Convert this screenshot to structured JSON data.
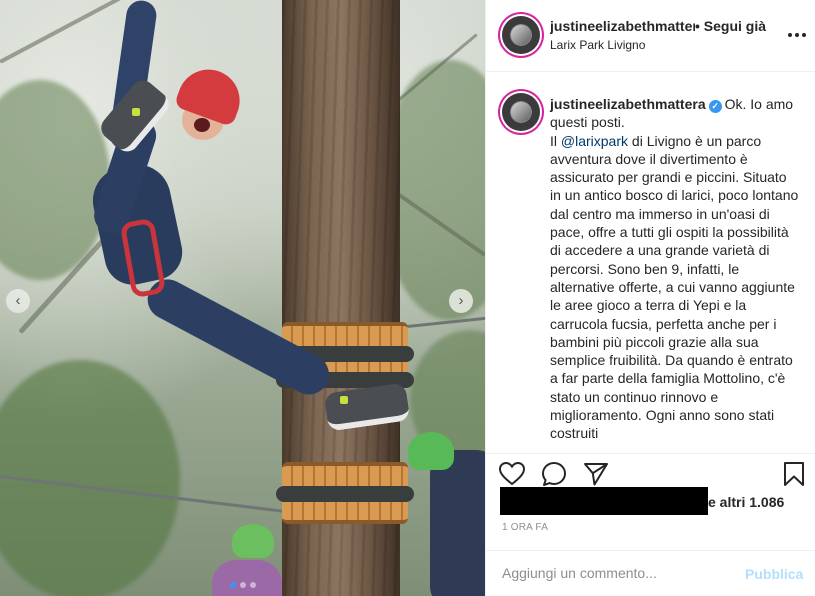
{
  "post": {
    "image_alt": "",
    "has_prev": true,
    "has_next": true,
    "carousel_count": 3,
    "carousel_active": 0
  },
  "header": {
    "username": "justineelizabethmattera",
    "follow_label": "• Segui già",
    "location": "Larix Park Livigno",
    "more_icon": "more-horizontal-icon"
  },
  "caption": {
    "username": "justineelizabethmattera",
    "verified_icon": "verified-badge-icon",
    "intro": "Ok. Io amo questi posti.",
    "pre_mention": "Il ",
    "mention": "@larixpark",
    "body": " di Livigno è un parco avventura dove il divertimento è assicurato per grandi e piccini. Situato in un antico bosco di larici, poco lontano dal centro ma immerso in un'oasi di pace, offre a tutti gli ospiti la possibilità di accedere a una grande varietà di percorsi. Sono ben 9, infatti, le alternative offerte, a cui vanno aggiunte le aree gioco a terra di Yepi e la carrucola fucsia, perfetta anche per i bambini più piccoli grazie alla sua semplice fruibilità. Da quando è entrato a far parte della famiglia Mottolino, c'è stato un continuo rinnovo e miglioramento. Ogni anno sono stati costruiti"
  },
  "actions": {
    "like_icon": "heart-icon",
    "comment_icon": "comment-bubble-icon",
    "share_icon": "paper-plane-icon",
    "save_icon": "bookmark-icon",
    "likes_suffix": "e altri 1.086",
    "time_ago": "1 ORA FA"
  },
  "comment": {
    "placeholder": "Aggiungi un commento...",
    "publish_label": "Pubblica"
  },
  "colors": {
    "accent_blue": "#3897f0",
    "publish_disabled": "#b2dffc",
    "text": "#262626",
    "muted": "#8e8e8e"
  }
}
